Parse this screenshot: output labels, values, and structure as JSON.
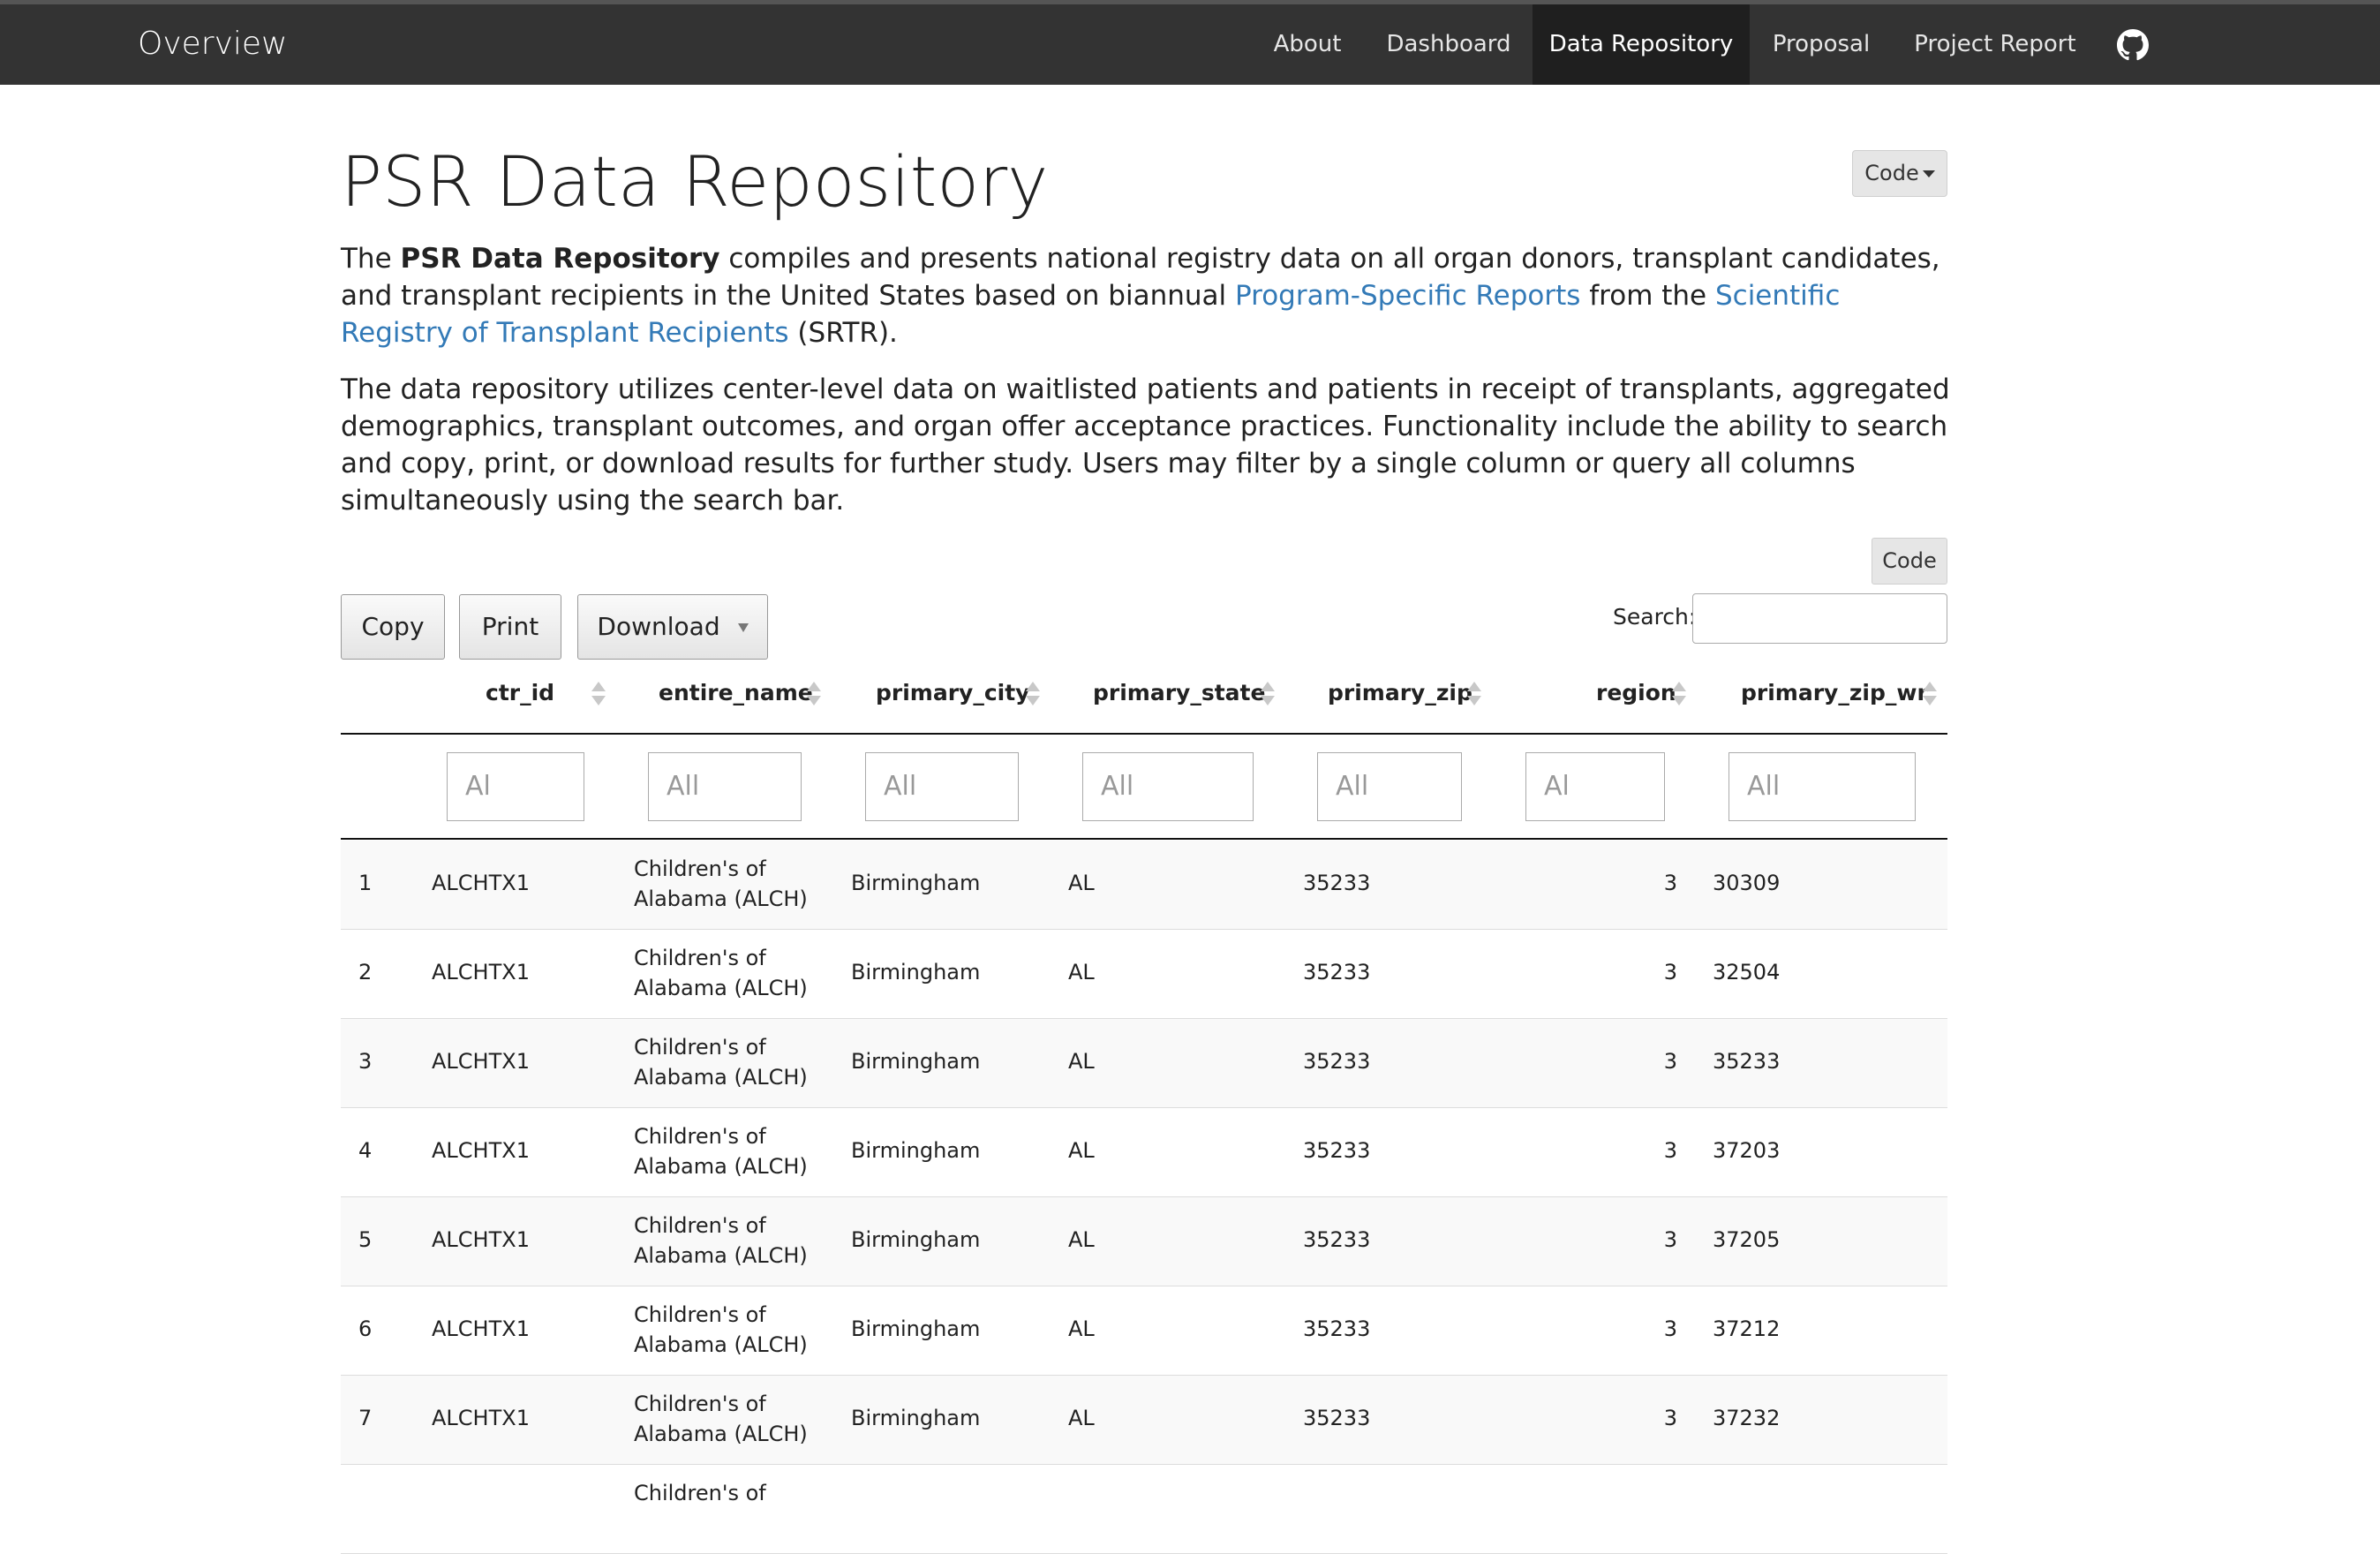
{
  "navbar": {
    "brand": "Overview",
    "items": [
      {
        "label": "About"
      },
      {
        "label": "Dashboard"
      },
      {
        "label": "Data Repository"
      },
      {
        "label": "Proposal"
      },
      {
        "label": "Project Report"
      }
    ],
    "github_icon": "github-icon"
  },
  "page": {
    "title": "PSR Data Repository",
    "code_menu_label": "Code",
    "intro": {
      "p1_part1": "The ",
      "p1_bold": "PSR Data Repository",
      "p1_part2": " compiles and presents national registry data on all organ donors, transplant candidates, and transplant recipients in the United States based on biannual ",
      "p1_link1": "Program-Specific Reports",
      "p1_part3": " from the ",
      "p1_link2": "Scientific Registry of Transplant Recipients",
      "p1_part4": " (SRTR).",
      "p2": "The data repository utilizes center-level data on waitlisted patients and patients in receipt of transplants, aggregated demographics, transplant outcomes, and organ offer acceptance practices. Functionality include the ability to search and copy, print, or download results for further study. Users may filter by a single column or query all columns simultaneously using the search bar."
    },
    "code_button_label": "Code"
  },
  "toolbar": {
    "copy_label": "Copy",
    "print_label": "Print",
    "download_label": "Download",
    "search_label": "Search:",
    "search_value": ""
  },
  "table": {
    "columns": [
      "ctr_id",
      "entire_name",
      "primary_city",
      "primary_state",
      "primary_zip",
      "region",
      "primary_zip_wr"
    ],
    "filters": [
      "Al",
      "All",
      "All",
      "All",
      "All",
      "Al",
      "All"
    ],
    "rows": [
      {
        "idx": "1",
        "ctr_id": "ALCHTX1",
        "name_l1": "Children's of",
        "name_l2": "Alabama (ALCH)",
        "city": "Birmingham",
        "state": "AL",
        "zip": "35233",
        "region": "3",
        "zip_wr": "30309"
      },
      {
        "idx": "2",
        "ctr_id": "ALCHTX1",
        "name_l1": "Children's of",
        "name_l2": "Alabama (ALCH)",
        "city": "Birmingham",
        "state": "AL",
        "zip": "35233",
        "region": "3",
        "zip_wr": "32504"
      },
      {
        "idx": "3",
        "ctr_id": "ALCHTX1",
        "name_l1": "Children's of",
        "name_l2": "Alabama (ALCH)",
        "city": "Birmingham",
        "state": "AL",
        "zip": "35233",
        "region": "3",
        "zip_wr": "35233"
      },
      {
        "idx": "4",
        "ctr_id": "ALCHTX1",
        "name_l1": "Children's of",
        "name_l2": "Alabama (ALCH)",
        "city": "Birmingham",
        "state": "AL",
        "zip": "35233",
        "region": "3",
        "zip_wr": "37203"
      },
      {
        "idx": "5",
        "ctr_id": "ALCHTX1",
        "name_l1": "Children's of",
        "name_l2": "Alabama (ALCH)",
        "city": "Birmingham",
        "state": "AL",
        "zip": "35233",
        "region": "3",
        "zip_wr": "37205"
      },
      {
        "idx": "6",
        "ctr_id": "ALCHTX1",
        "name_l1": "Children's of",
        "name_l2": "Alabama (ALCH)",
        "city": "Birmingham",
        "state": "AL",
        "zip": "35233",
        "region": "3",
        "zip_wr": "37212"
      },
      {
        "idx": "7",
        "ctr_id": "ALCHTX1",
        "name_l1": "Children's of",
        "name_l2": "Alabama (ALCH)",
        "city": "Birmingham",
        "state": "AL",
        "zip": "35233",
        "region": "3",
        "zip_wr": "37232"
      },
      {
        "idx": "",
        "ctr_id": "",
        "name_l1": "Children's of",
        "name_l2": "",
        "city": "",
        "state": "",
        "zip": "",
        "region": "",
        "zip_wr": ""
      }
    ]
  },
  "colors": {
    "navbar_bg": "#333333",
    "nav_active_bg": "#1f1f1f",
    "link": "#337ab7"
  }
}
